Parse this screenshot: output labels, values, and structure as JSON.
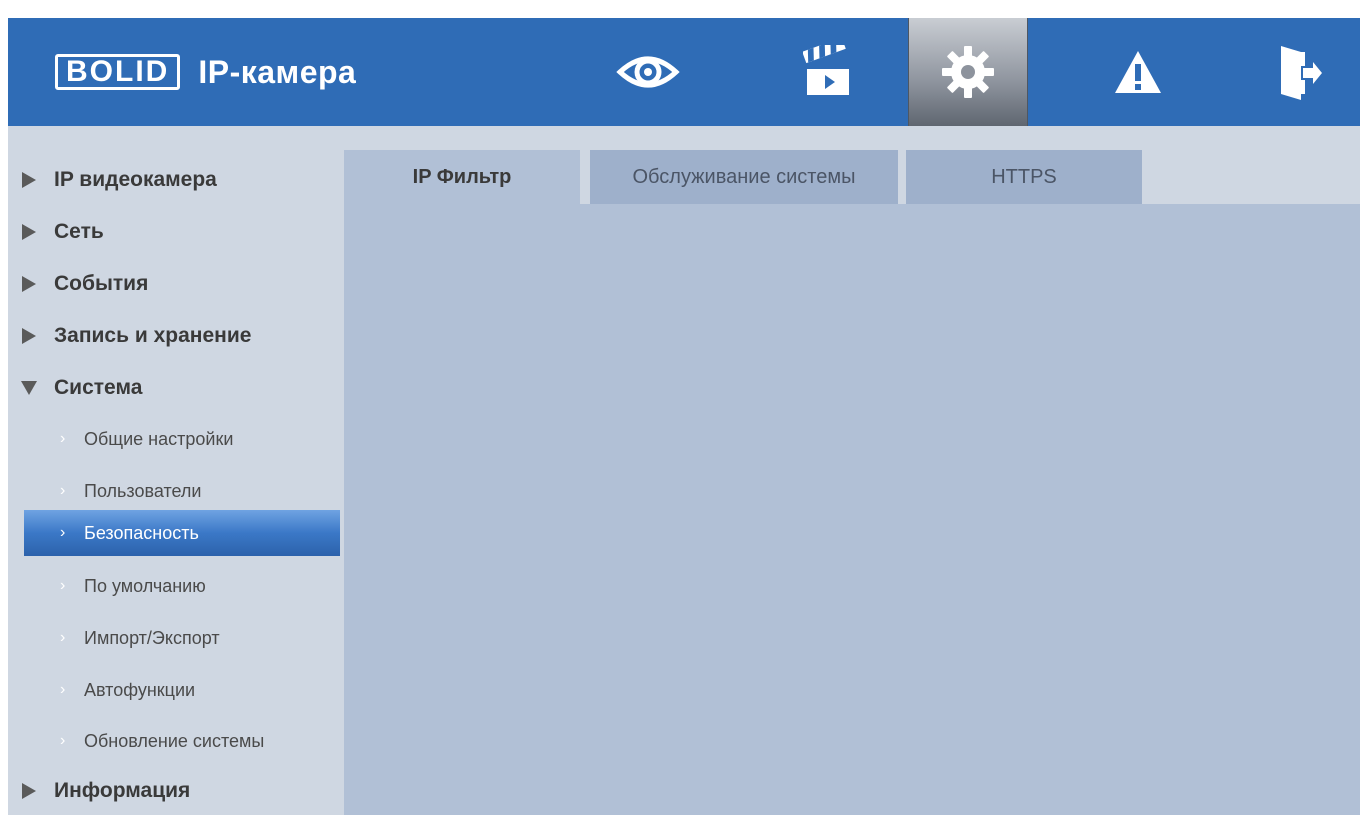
{
  "header": {
    "logo_text": "BOLID",
    "title": "IP-камера",
    "nav": [
      {
        "icon": "eye-icon"
      },
      {
        "icon": "clapperboard-icon"
      },
      {
        "icon": "gear-icon",
        "active": true
      },
      {
        "icon": "warning-icon"
      },
      {
        "icon": "logout-icon"
      }
    ],
    "brand_color": "#2f6cb6"
  },
  "sidebar": {
    "items": [
      {
        "label": "IP видеокамера",
        "level": "top",
        "expanded": false
      },
      {
        "label": "Сеть",
        "level": "top",
        "expanded": false
      },
      {
        "label": "События",
        "level": "top",
        "expanded": false
      },
      {
        "label": "Запись и хранение",
        "level": "top",
        "expanded": false
      },
      {
        "label": "Система",
        "level": "top",
        "expanded": true
      },
      {
        "label": "Общие настройки",
        "level": "sub"
      },
      {
        "label": "Пользователи",
        "level": "sub"
      },
      {
        "label": "Безопасность",
        "level": "sub",
        "active": true
      },
      {
        "label": "По умолчанию",
        "level": "sub"
      },
      {
        "label": "Импорт/Экспорт",
        "level": "sub"
      },
      {
        "label": "Автофункции",
        "level": "sub"
      },
      {
        "label": "Обновление системы",
        "level": "sub"
      },
      {
        "label": "Информация",
        "level": "top",
        "expanded": false
      }
    ]
  },
  "tabs": [
    {
      "label": "IP Фильтр",
      "active": true
    },
    {
      "label": "Обслуживание системы",
      "active": false
    },
    {
      "label": "HTTPS",
      "active": false
    }
  ]
}
